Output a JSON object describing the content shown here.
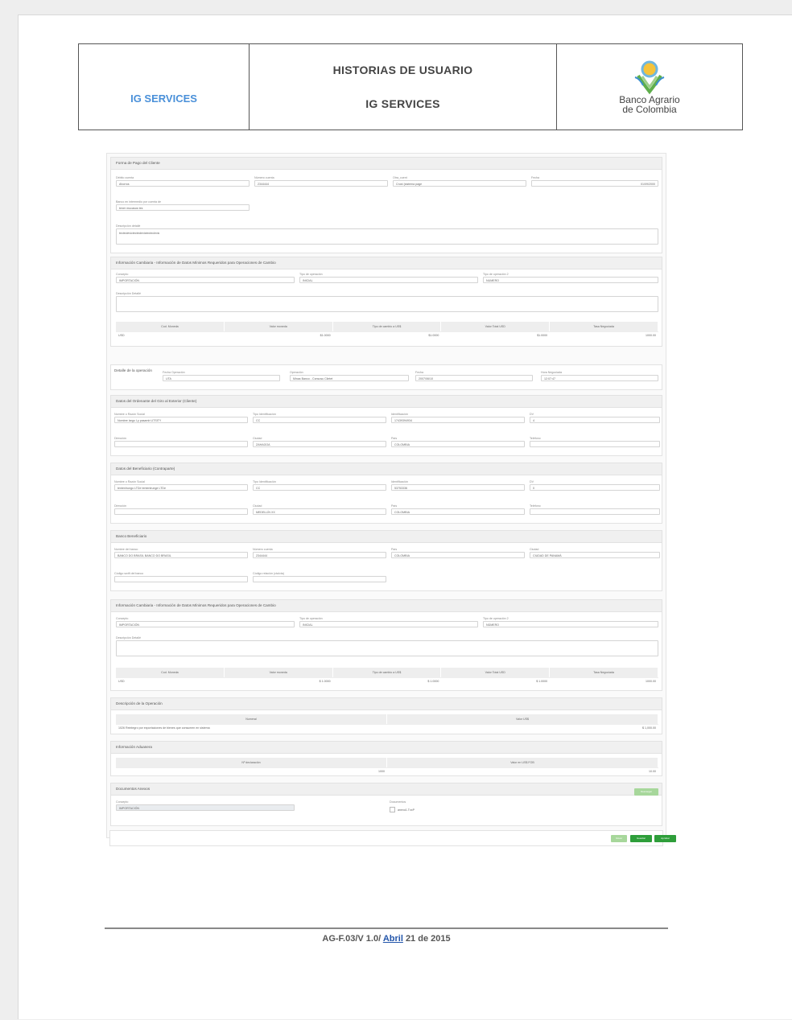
{
  "header": {
    "left_title": "IG SERVICES",
    "center_line1": "HISTORIAS DE USUARIO",
    "center_line2": "IG SERVICES",
    "logo_line1": "Banco Agrario",
    "logo_line2": "de Colombia"
  },
  "forma_pago": {
    "title": "Forma de Pago del Cliente",
    "f1_label": "Débito cuenta",
    "f1_value": "Ahorros",
    "f2_label": "Número cuenta",
    "f2_value": "2344444",
    "f3_label": "Otra_cuent",
    "f3_value": "Crust (sistema page",
    "f4_label": "Fecha",
    "f4_value": "01/09/2000",
    "f5_label": "Banco en intermedio por cuenta de",
    "f5_value": "tener mucasos tes",
    "f6_label": "Descripción detallé",
    "f6_value": "tecteclevictecteclevictecteclevic"
  },
  "info_cambiaria1": {
    "title": "Información Cambiaria - Información de Datos Mínimos Requeridos para Operaciones de Cambio",
    "f1_label": "Concepto",
    "f1_value": "IMPORTACIÓN",
    "f2_label": "Tipo de operación",
    "f2_value": "INICIAL",
    "f3_label": "Tipo de operación 2",
    "f3_value": "NUMERO",
    "f4_label": "Descripción Detallé",
    "cols": [
      "Cod. Moneda",
      "Valor moneda",
      "Tipo de cambio a US$",
      "Valor Total USD",
      "Tasa Negociada"
    ],
    "row": [
      "USD",
      "$1.0000",
      "$1.0000",
      "$1.0000",
      "1000.00"
    ]
  },
  "detalle_op": {
    "title": "Detalle de la operación",
    "f1_label": "Fecha Operación",
    "f1_value": "UTA",
    "f2_label": "Operación",
    "f2_value": "Minas Banco - Consosu Clietet",
    "f3_label": "Fecha",
    "f3_value": "2007/06/10",
    "f4_label": "Hora Negociada",
    "f4_value": "12:07:47"
  },
  "ordenante": {
    "title": "Datos del Ordenante del Giro al Exterior (Cliente)",
    "f1_label": "Nombre o Razón Social",
    "f1_value": "Nombre largo I-y pasamb UTSITY",
    "f2_label": "Tipo Identificación",
    "f2_value": "CC",
    "f3_label": "Identificación",
    "f3_value": "17439394934",
    "f4_label": "DV",
    "f4_value": "4",
    "f5_label": "Dirección",
    "f5_value": "",
    "f6_label": "Ciudad",
    "f6_value": "ZAHAGOA",
    "f7_label": "País",
    "f7_value": "COLOMBIA",
    "f8_label": "Teléfono",
    "f8_value": ""
  },
  "beneficiario": {
    "title": "Datos del Beneficiario (Contraparte)",
    "f1_label": "Nombre o Razón Social",
    "f1_value": "tentenlrungo LTDe tentenlrunge LTDe",
    "f2_label": "Tipo Identificación",
    "f2_value": "CC",
    "f3_label": "Identificación",
    "f3_value": "53753336",
    "f4_label": "DV",
    "f4_value": "0",
    "f5_label": "Dirección",
    "f5_value": "",
    "f6_label": "Ciudad",
    "f6_value": "MEDELLÍN XX",
    "f7_label": "País",
    "f7_value": "COLOMBIA",
    "f8_label": "Teléfono",
    "f8_value": ""
  },
  "banco_benef": {
    "title": "Banco Beneficiario",
    "f1_label": "Nombre del banco",
    "f1_value": "BANCO DO BRASIL BANCO DO BRASIL",
    "f2_label": "Número cuenta",
    "f2_value": "2344444",
    "f3_label": "País",
    "f3_value": "COLOMBIA",
    "f4_label": "Ciudad",
    "f4_value": "CIUDAD DE PANAMÁ",
    "f5_label": "Código swift del banco",
    "f5_value": "",
    "f6_label": "Código relación (cta/cta)",
    "f6_value": ""
  },
  "info_cambiaria2": {
    "title": "Información Cambiaria - Información de Datos Mínimos Requeridos para Operaciones de Cambio",
    "f1_label": "Concepto",
    "f1_value": "IMPORTACIÓN",
    "f2_label": "Tipo de operación",
    "f2_value": "INICIAL",
    "f3_label": "Tipo de operación 2",
    "f3_value": "NÚMERO",
    "f4_label": "Descripción Detallé",
    "cols": [
      "Cod. Moneda",
      "Valor moneda",
      "Tipo de cambio a US$",
      "Valor Total USD",
      "Tasa Negociada"
    ],
    "row": [
      "USD",
      "$ 1.0000",
      "$ 1.0000",
      "$ 1.0000",
      "1000.00"
    ]
  },
  "desc_op": {
    "title": "Descripción de la Operación",
    "cols": [
      "Numeral",
      "Valor US$"
    ],
    "row": [
      "1026 Reintegro por exportaciones de bienes que consumen en sistema",
      "$ 1,000.00"
    ]
  },
  "aduanera": {
    "title": "Información Aduanera",
    "cols": [
      "Nº declaración",
      "Valor en US$ FOB"
    ],
    "row": [
      "1000",
      "10.00"
    ]
  },
  "documentos": {
    "title": "Documentos Anexos",
    "f1_label": "Concepto",
    "f1_value": "IMPORTACIÓN",
    "f2_label": "Documentos",
    "f2_value": "anexo1.TxxP",
    "upload_btn": "Descargar"
  },
  "actions": {
    "b1": "Volver",
    "b2": "Guardar",
    "b3": "Aprobar"
  },
  "footer": {
    "prefix": "AG-F.03/V 1.0/",
    "month": "Abril",
    "suffix": "21 de 2015"
  },
  "colors": {
    "accent_blue": "#4a90d9",
    "btn_green": "#2e9e3a",
    "btn_green_light": "#a7d79b"
  }
}
